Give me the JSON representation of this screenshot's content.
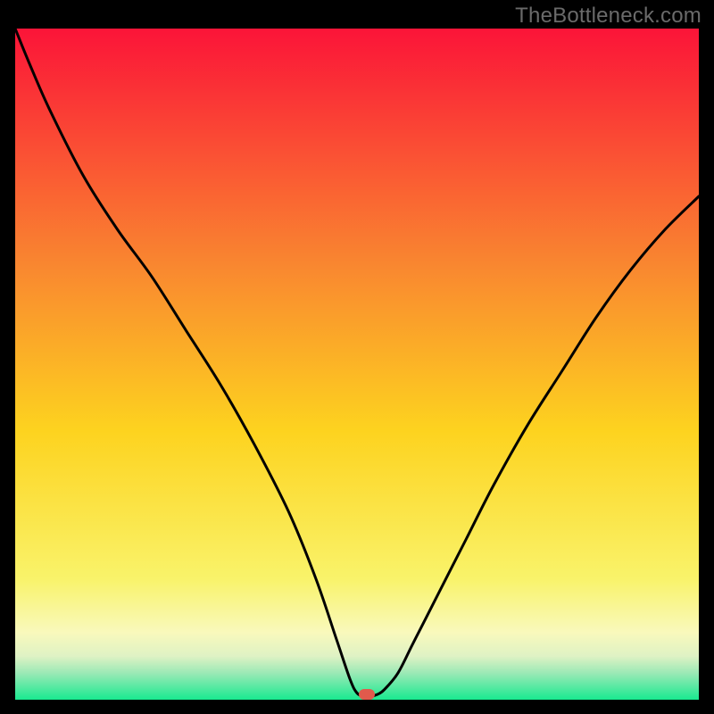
{
  "watermark": "TheBottleneck.com",
  "colors": {
    "gradient_top": "#fb1438",
    "gradient_mid_upper": "#f98f30",
    "gradient_mid": "#fdd71f",
    "gradient_low": "#f9f89a",
    "gradient_band": "#d4f0bc",
    "gradient_bottom": "#19e990",
    "curve": "#000000",
    "marker": "#e15a4c",
    "frame": "#000000"
  },
  "chart_data": {
    "type": "line",
    "title": "",
    "xlabel": "",
    "ylabel": "",
    "xlim": [
      0,
      100
    ],
    "ylim": [
      0,
      100
    ],
    "annotations": [
      {
        "kind": "marker",
        "x": 51.5,
        "y": 0.8,
        "label": ""
      }
    ],
    "series": [
      {
        "name": "curve",
        "x": [
          0,
          2,
          5,
          10,
          15,
          20,
          25,
          30,
          35,
          40,
          44,
          47,
          49,
          50,
          51,
          52,
          53,
          54,
          56,
          58,
          60,
          63,
          66,
          70,
          75,
          80,
          85,
          90,
          95,
          100
        ],
        "y": [
          100,
          95,
          88,
          78,
          70,
          63,
          55,
          47,
          38,
          28,
          18,
          9,
          3,
          1,
          0.5,
          0.5,
          0.8,
          1.5,
          4,
          8,
          12,
          18,
          24,
          32,
          41,
          49,
          57,
          64,
          70,
          75
        ]
      }
    ],
    "background_gradient_stops": [
      {
        "pos": 0.0,
        "color": "#fb1438"
      },
      {
        "pos": 0.35,
        "color": "#f98630"
      },
      {
        "pos": 0.6,
        "color": "#fdd31f"
      },
      {
        "pos": 0.82,
        "color": "#f9f36a"
      },
      {
        "pos": 0.9,
        "color": "#f9f9bc"
      },
      {
        "pos": 0.935,
        "color": "#dff2c4"
      },
      {
        "pos": 0.96,
        "color": "#9ce9b6"
      },
      {
        "pos": 1.0,
        "color": "#19e990"
      }
    ]
  }
}
